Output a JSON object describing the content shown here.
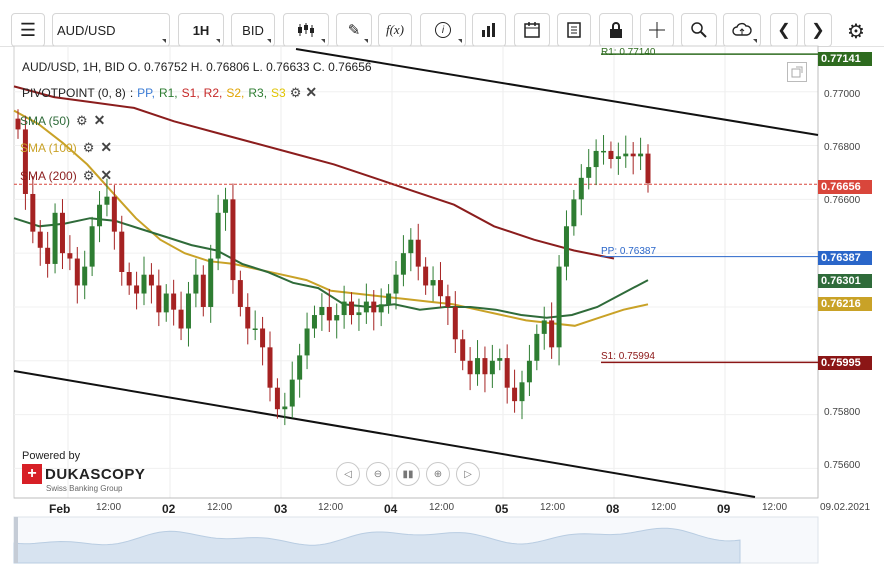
{
  "toolbar": {
    "symbol": "AUD/USD",
    "timeframe": "1H",
    "side": "BID"
  },
  "legend": {
    "ohlc": "AUD/USD, 1H, BID    O. 0.76752 H. 0.76806 L. 0.76633 C. 0.76656",
    "pivot_label": "PIVOTPOINT (0, 8)",
    "pivot_separator": ":",
    "pivot_levels": [
      "PP,",
      "R1,",
      "S1,",
      "R2,",
      "S2,",
      "R3,",
      "S3"
    ],
    "pivot_colors": [
      "#3a7bd5",
      "#2e7d32",
      "#c62828",
      "#c62828",
      "#e0a300",
      "#2e7d32",
      "#e0c400"
    ],
    "sma50": "SMA (50)",
    "sma100": "SMA (100)",
    "sma200": "SMA (200)"
  },
  "level_labels": {
    "r1": "R1: 0.77140",
    "pp": "PP: 0.76387",
    "s1": "S1: 0.75994"
  },
  "price_tags": {
    "r1": "0.77141",
    "close": "0.76656",
    "pp": "0.76387",
    "sma50": "0.76301",
    "sma100": "0.76216",
    "s1": "0.75995"
  },
  "colors": {
    "r1": "#2e6b1f",
    "close": "#d9463b",
    "pp": "#2a66c9",
    "sma50": "#2f6b3a",
    "sma100": "#c9a227",
    "sma200": "#8b1d1d",
    "s1": "#8b1616",
    "bull": "#2e7d32",
    "bear": "#a52222"
  },
  "branding": {
    "powered_by": "Powered by",
    "brand": "DUKASCOPY",
    "tagline": "Swiss Banking Group"
  },
  "bottom_right_date": "09.02.2021",
  "chart_data": {
    "type": "candlestick",
    "symbol": "AUD/USD",
    "interval": "1H",
    "ylim": [
      0.7549,
      0.7717
    ],
    "y_ticks": [
      "0.77000",
      "0.76800",
      "0.76600",
      "0.75800",
      "0.75600"
    ],
    "x_ticks": [
      "Feb",
      "12:00",
      "02",
      "12:00",
      "03",
      "12:00",
      "04",
      "12:00",
      "05",
      "12:00",
      "08",
      "12:00",
      "09",
      "12:00"
    ],
    "close_values": [
      0.7686,
      0.7662,
      0.7648,
      0.7642,
      0.7636,
      0.7655,
      0.764,
      0.7638,
      0.7628,
      0.7635,
      0.765,
      0.7658,
      0.7661,
      0.7648,
      0.7633,
      0.7628,
      0.7625,
      0.7632,
      0.7628,
      0.7618,
      0.7625,
      0.7619,
      0.7612,
      0.7625,
      0.7632,
      0.762,
      0.7638,
      0.7655,
      0.766,
      0.763,
      0.762,
      0.7612,
      0.7612,
      0.7605,
      0.759,
      0.7582,
      0.7583,
      0.7593,
      0.7602,
      0.7612,
      0.7617,
      0.762,
      0.7615,
      0.7617,
      0.7622,
      0.7617,
      0.7618,
      0.7622,
      0.7618,
      0.7621,
      0.7625,
      0.7632,
      0.764,
      0.7645,
      0.7635,
      0.7628,
      0.763,
      0.7624,
      0.762,
      0.7608,
      0.76,
      0.7595,
      0.7601,
      0.7595,
      0.76,
      0.7601,
      0.759,
      0.7585,
      0.7592,
      0.76,
      0.761,
      0.7615,
      0.7605,
      0.7635,
      0.765,
      0.766,
      0.7668,
      0.7672,
      0.7678,
      0.7678,
      0.7675,
      0.7676,
      0.7677,
      0.7676,
      0.7677,
      0.7666
    ],
    "sma50": [
      0.7653,
      0.765,
      0.7651,
      0.7653,
      0.7652,
      0.7649,
      0.7646,
      0.7643,
      0.7641,
      0.7636,
      0.7633,
      0.7629,
      0.7627,
      0.7621,
      0.762,
      0.7621,
      0.7619,
      0.762,
      0.762,
      0.7619,
      0.7617,
      0.7616,
      0.7617,
      0.762,
      0.7625,
      0.763
    ],
    "sma100": [
      0.7693,
      0.7688,
      0.7681,
      0.7673,
      0.7663,
      0.7653,
      0.7645,
      0.764,
      0.7637,
      0.7636,
      0.7634,
      0.7632,
      0.763,
      0.7626,
      0.7625,
      0.7624,
      0.7623,
      0.7622,
      0.7621,
      0.7619,
      0.7617,
      0.7615,
      0.7614,
      0.7613,
      0.7616,
      0.7619,
      0.7621
    ],
    "sma200": [
      0.7702,
      0.7698,
      0.7696,
      0.7694,
      0.7689,
      0.7685,
      0.7681,
      0.7677,
      0.7673,
      0.7668,
      0.7663,
      0.7658,
      0.765,
      0.7645,
      0.7641,
      0.7638
    ],
    "pivot": {
      "R1": 0.7714,
      "PP": 0.76387,
      "S1": 0.75994
    },
    "close": 0.76656
  }
}
